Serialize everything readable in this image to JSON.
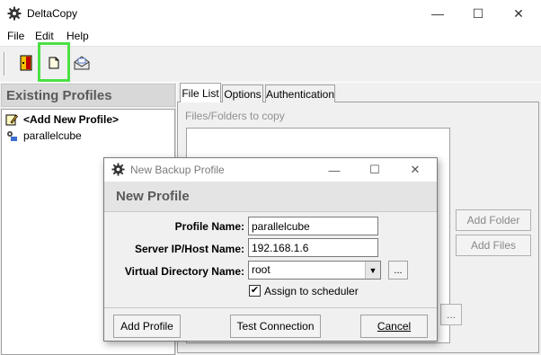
{
  "window": {
    "title": "DeltaCopy"
  },
  "menu": {
    "file": "File",
    "edit": "Edit",
    "help": "Help"
  },
  "window_controls": {
    "minimize": "—",
    "maximize": "☐",
    "close": "✕"
  },
  "left_panel": {
    "title": "Existing Profiles",
    "items": [
      {
        "label": "<Add New Profile>"
      },
      {
        "label": "parallelcube"
      }
    ]
  },
  "tabs": [
    {
      "label": "File List"
    },
    {
      "label": "Options"
    },
    {
      "label": "Authentication"
    }
  ],
  "file_list": {
    "label": "Files/Folders to copy",
    "add_folder": "Add Folder",
    "add_files": "Add Files",
    "ellipsis": "..."
  },
  "dialog": {
    "title": "New Backup Profile",
    "header": "New Profile",
    "profile_name_label": "Profile Name:",
    "profile_name_value": "parallelcube",
    "server_label": "Server IP/Host Name:",
    "server_value": "192.168.1.6",
    "vdir_label": "Virtual Directory Name:",
    "vdir_value": "root",
    "browse": "...",
    "assign_label": "Assign to scheduler",
    "assign_checked": true,
    "add_profile": "Add Profile",
    "test_connection": "Test Connection",
    "cancel": "Cancel"
  },
  "icons": {
    "app": "deltacopy-gear-icon",
    "exit": "exit-door-icon",
    "new_profile": "new-document-icon",
    "email": "email-envelope-icon",
    "add_profile": "note-pencil-icon",
    "profile": "profile-gear-icon"
  },
  "colors": {
    "highlight": "#4ce045"
  }
}
